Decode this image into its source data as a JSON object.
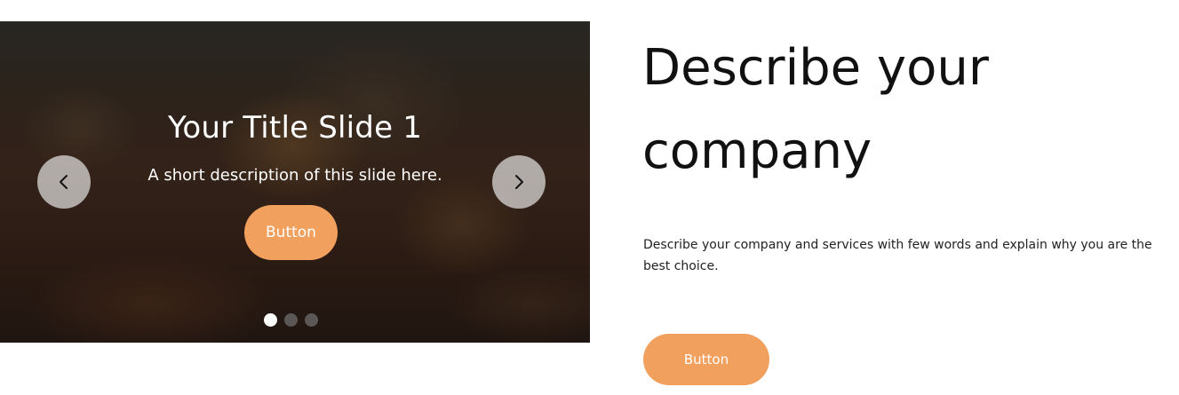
{
  "slider": {
    "slide": {
      "title": "Your Title Slide 1",
      "description": "A short description of this slide here.",
      "button_label": "Button"
    },
    "prev_icon": "chevron-left-icon",
    "next_icon": "chevron-right-icon",
    "dots_count": 3,
    "active_dot": 1
  },
  "content": {
    "heading": "Describe your company",
    "body": "Describe your company and services with few words and explain why you are the best choice.",
    "button_label": "Button"
  },
  "colors": {
    "accent": "#f2a05e",
    "heading_text": "#111111",
    "body_text": "#222222"
  }
}
